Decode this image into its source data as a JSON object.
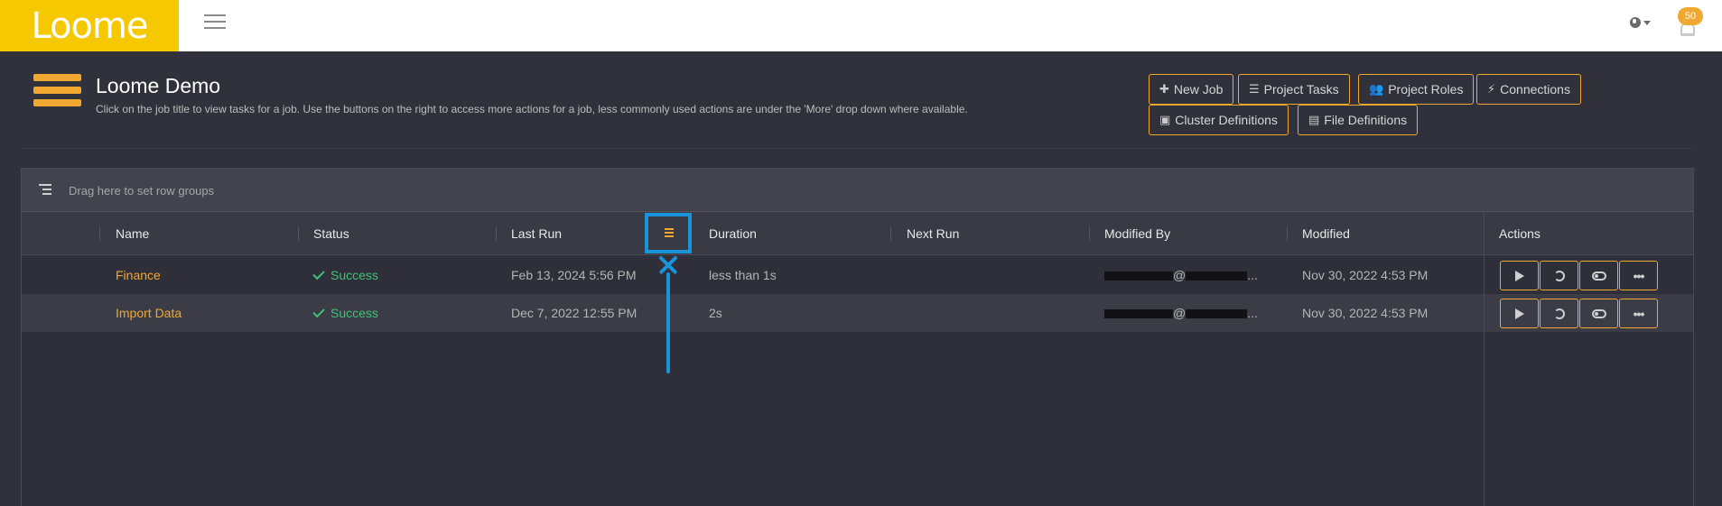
{
  "app": {
    "logo_text": "Loome",
    "notifications_count": "50"
  },
  "header": {
    "title": "Loome Demo",
    "description": "Click on the job title to view tasks for a job. Use the buttons on the right to access more actions for a job, less commonly used actions are under the 'More' drop down where available."
  },
  "toolbar": {
    "new_job": "New Job",
    "project_tasks": "Project Tasks",
    "project_roles": "Project Roles",
    "connections": "Connections",
    "cluster_definitions": "Cluster Definitions",
    "file_definitions": "File Definitions"
  },
  "grid": {
    "group_placeholder": "Drag here to set row groups",
    "columns": {
      "name": "Name",
      "status": "Status",
      "last_run": "Last Run",
      "duration": "Duration",
      "next_run": "Next Run",
      "modified_by": "Modified By",
      "modified": "Modified",
      "actions": "Actions"
    },
    "rows": [
      {
        "name": "Finance",
        "status": "Success",
        "last_run": "Feb 13, 2024 5:56 PM",
        "duration": "less than 1s",
        "next_run": "",
        "modified_by_at": "@",
        "modified_by_ellipsis": "...",
        "modified": "Nov 30, 2022 4:53 PM"
      },
      {
        "name": "Import Data",
        "status": "Success",
        "last_run": "Dec 7, 2022 12:55 PM",
        "duration": "2s",
        "next_run": "",
        "modified_by_at": "@",
        "modified_by_ellipsis": "...",
        "modified": "Nov 30, 2022 4:53 PM"
      }
    ]
  },
  "colors": {
    "accent": "#f0a830",
    "logo_bg": "#f5c800",
    "success": "#3ec27a",
    "annotation": "#1a93d9",
    "background": "#31313b"
  },
  "icons": {
    "menu": "hamburger-icon",
    "globe": "globe-icon",
    "bell": "bell-icon",
    "run": "play-icon",
    "history": "history-icon",
    "toggle": "toggle-icon",
    "more": "ellipsis-icon"
  }
}
